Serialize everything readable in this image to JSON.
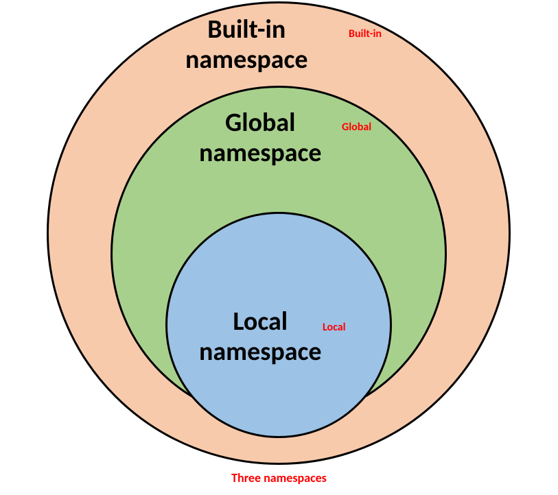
{
  "circles": {
    "outer": {
      "label_line1": "Built-in",
      "label_line2": "namespace",
      "annotation": "Built-in",
      "color": "#f7caac"
    },
    "middle": {
      "label_line1": "Global",
      "label_line2": "namespace",
      "annotation": "Global",
      "color": "#a8d08d"
    },
    "inner": {
      "label_line1": "Local",
      "label_line2": "namespace",
      "annotation": "Local",
      "color": "#9cc2e5"
    }
  },
  "caption": "Three namespaces"
}
